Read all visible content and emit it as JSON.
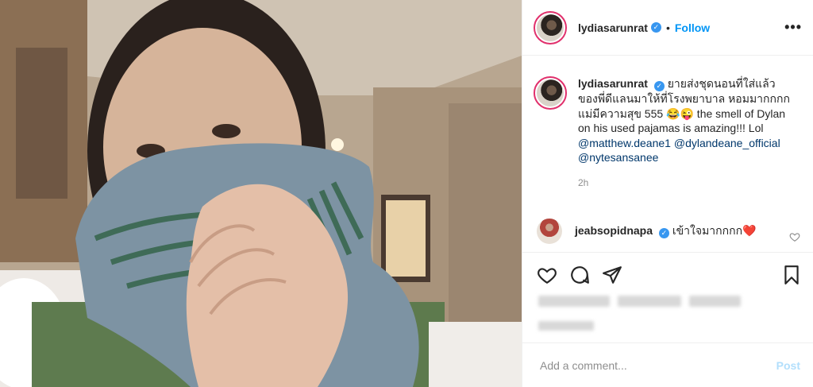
{
  "post": {
    "author": "lydiasarunrat",
    "follow_label": "Follow",
    "dot": "•",
    "more_label": "•••",
    "verified_glyph": "✓",
    "caption": {
      "username": "lydiasarunrat",
      "text": "ยายส่งชุดนอนที่ใส่แล้วของพี่ดีแลนมาให้ที่โรงพยาบาล หอมมากกกก แม่มีความสุข 555 😂😜 the smell of Dylan on his used pajamas is amazing!!! Lol",
      "mentions": [
        "@matthew.deane1",
        "@dylandeane_official",
        "@nytesansanee"
      ],
      "time": "2h"
    },
    "comment": {
      "username": "jeabsopidnapa",
      "text": "เข้าใจมากกกก❤️"
    },
    "add_comment_placeholder": "Add a comment...",
    "post_button": "Post",
    "colors": {
      "accent": "#0095f6",
      "verified": "#3897f0",
      "ring": "#e1306c"
    }
  }
}
